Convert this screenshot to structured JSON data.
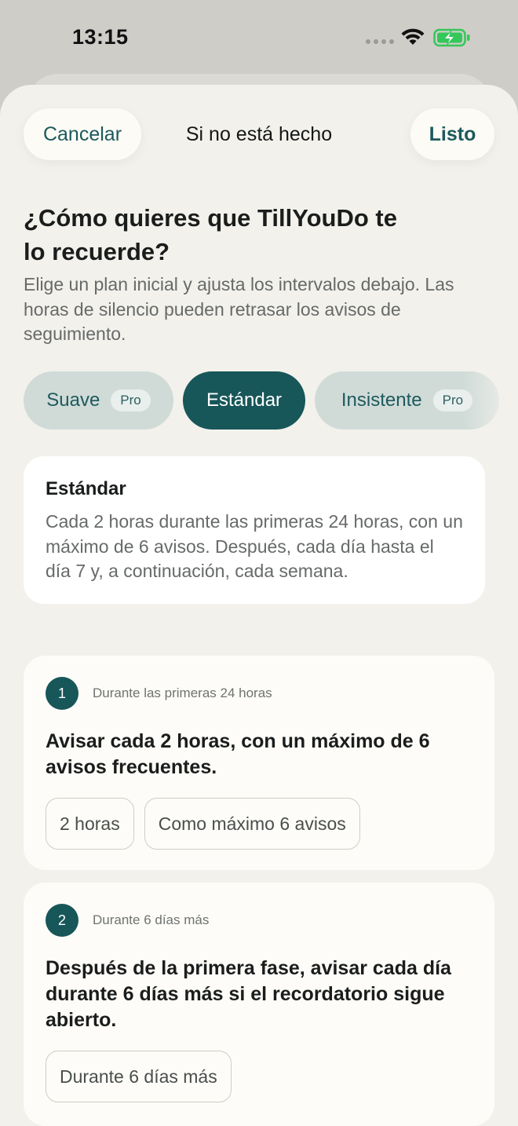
{
  "status_bar": {
    "time": "13:15"
  },
  "nav": {
    "cancel": "Cancelar",
    "title": "Si no está hecho",
    "done": "Listo"
  },
  "heading": {
    "line1": "¿Cómo quieres que TillYouDo te",
    "line2": "lo recuerde?"
  },
  "subtext": "Elige un plan inicial y ajusta los intervalos debajo. Las horas de silencio pueden retrasar los avisos de seguimiento.",
  "presets": [
    {
      "label": "Suave",
      "badge": "Pro"
    },
    {
      "label": "Estándar",
      "badge": ""
    },
    {
      "label": "Insistente",
      "badge": "Pro"
    }
  ],
  "selected_preset": "Estándar",
  "summary": {
    "title": "Estándar",
    "description": "Cada 2 horas durante las primeras 24 horas, con un máximo de 6 avisos. Después, cada día hasta el día 7 y, a continuación, cada semana."
  },
  "phases": [
    {
      "number": "1",
      "label": "Durante las primeras 24 horas",
      "text": "Avisar cada 2 horas, con un máximo de 6 avisos frecuentes.",
      "chips": [
        "2 horas",
        "Como máximo 6 avisos"
      ]
    },
    {
      "number": "2",
      "label": "Durante 6 días más",
      "text": "Después de la primera fase, avisar cada día durante 6 días más si el recordatorio sigue abierto.",
      "chips": [
        "Durante 6 días más"
      ]
    }
  ],
  "colors": {
    "accent": "#175659",
    "accent_text": "#1b5a5d",
    "battery": "#34c759"
  }
}
